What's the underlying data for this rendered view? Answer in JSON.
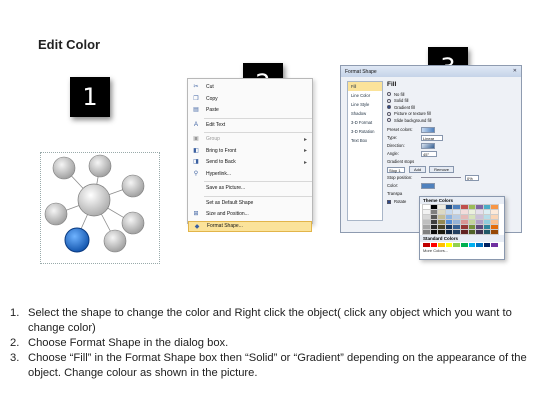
{
  "page": {
    "title": "Edit Color"
  },
  "badges": [
    "1",
    "2",
    "3"
  ],
  "menu": {
    "items": [
      {
        "label": "Cut",
        "icon": "scissors-icon",
        "glyph": "✂",
        "disabled": false,
        "submenu": false
      },
      {
        "label": "Copy",
        "icon": "copy-icon",
        "glyph": "❐",
        "disabled": false,
        "submenu": false
      },
      {
        "label": "Paste",
        "icon": "paste-icon",
        "glyph": "▤",
        "disabled": false,
        "submenu": false
      },
      {
        "label": "Edit Text",
        "icon": "edit-text-icon",
        "glyph": "A",
        "disabled": false,
        "submenu": false
      },
      {
        "label": "Group",
        "icon": "group-icon",
        "glyph": "▣",
        "disabled": true,
        "submenu": true
      },
      {
        "label": "Bring to Front",
        "icon": "bring-front-icon",
        "glyph": "◧",
        "disabled": false,
        "submenu": true
      },
      {
        "label": "Send to Back",
        "icon": "send-back-icon",
        "glyph": "◨",
        "disabled": false,
        "submenu": true
      },
      {
        "label": "Hyperlink...",
        "icon": "hyperlink-icon",
        "glyph": "⚲",
        "disabled": false,
        "submenu": false
      },
      {
        "label": "Save as Picture...",
        "icon": "",
        "glyph": "",
        "disabled": false,
        "submenu": false
      },
      {
        "label": "Set as Default Shape",
        "icon": "",
        "glyph": "",
        "disabled": false,
        "submenu": false
      },
      {
        "label": "Size and Position...",
        "icon": "size-icon",
        "glyph": "⊞",
        "disabled": false,
        "submenu": false
      },
      {
        "label": "Format Shape...",
        "icon": "format-shape-icon",
        "glyph": "◆",
        "disabled": false,
        "submenu": false,
        "highlight": true
      }
    ]
  },
  "dialog": {
    "title": "Format Shape",
    "categories": [
      "Fill",
      "Line Color",
      "Line Style",
      "Shadow",
      "3-D Format",
      "3-D Rotation",
      "Text Box"
    ],
    "fill_heading": "Fill",
    "fill_options": [
      "No fill",
      "Solid fill",
      "Gradient fill",
      "Picture or texture fill",
      "Slide background fill"
    ],
    "fill_selected": 2,
    "preset_colors_label": "Preset colors:",
    "type_label": "Type:",
    "type_value": "Linear",
    "direction_label": "Direction:",
    "angle_label": "Angle:",
    "angle_value": "45°",
    "gradient_stops_label": "Gradient stops",
    "stop_value": "Stop 1",
    "add_label": "Add",
    "remove_label": "Remove",
    "stop_position_label": "Stop position:",
    "stop_position_value": "0%",
    "color_label": "Color:",
    "transparency_label": "Transpa",
    "rotate_label": "Rotate"
  },
  "picker": {
    "theme_header": "Theme Colors",
    "standard_header": "Standard Colors",
    "more_label": "More Colors...",
    "theme_rows": [
      [
        "#ffffff",
        "#000000",
        "#eeece1",
        "#1f497d",
        "#4f81bd",
        "#c0504d",
        "#9bbb59",
        "#8064a2",
        "#4bacc6",
        "#f79646"
      ],
      [
        "#f2f2f2",
        "#7f7f7f",
        "#ddd9c3",
        "#c6d9f0",
        "#dbe5f1",
        "#f2dcdb",
        "#ebf1dd",
        "#e5e0ec",
        "#dbeef3",
        "#fdeada"
      ],
      [
        "#d8d8d8",
        "#595959",
        "#c4bd97",
        "#8db3e2",
        "#b8cce4",
        "#e5b9b7",
        "#d7e3bc",
        "#ccc1d9",
        "#b7dde8",
        "#fbd5b5"
      ],
      [
        "#bfbfbf",
        "#3f3f3f",
        "#938953",
        "#548dd4",
        "#95b3d7",
        "#d99694",
        "#c3d69b",
        "#b2a2c7",
        "#92cddc",
        "#fac08f"
      ],
      [
        "#a5a5a5",
        "#262626",
        "#494429",
        "#17365d",
        "#366092",
        "#953734",
        "#76923c",
        "#5f497a",
        "#31859b",
        "#e36c09"
      ],
      [
        "#7f7f7f",
        "#0c0c0c",
        "#1d1b10",
        "#0f243e",
        "#244061",
        "#632423",
        "#4f6128",
        "#3f3151",
        "#205867",
        "#974806"
      ]
    ],
    "standard_row": [
      "#c00000",
      "#ff0000",
      "#ffc000",
      "#ffff00",
      "#92d050",
      "#00b050",
      "#00b0f0",
      "#0070c0",
      "#002060",
      "#7030a0"
    ]
  },
  "diagram": {
    "center_color": "#d9d9d9",
    "node_color": "#bfbfbf",
    "selected_color": "#1f6fd1"
  },
  "steps": [
    {
      "num": "1.",
      "text": "Select the shape to change the color and Right click the object( click any object which you want to change color)"
    },
    {
      "num": "2.",
      "text": "Choose Format Shape in the dialog box."
    },
    {
      "num": "3.",
      "text": "Choose “Fill” in the Format Shape box then “Solid” or “Gradient” depending on the appearance of the object. Change colour as shown in the picture."
    }
  ]
}
